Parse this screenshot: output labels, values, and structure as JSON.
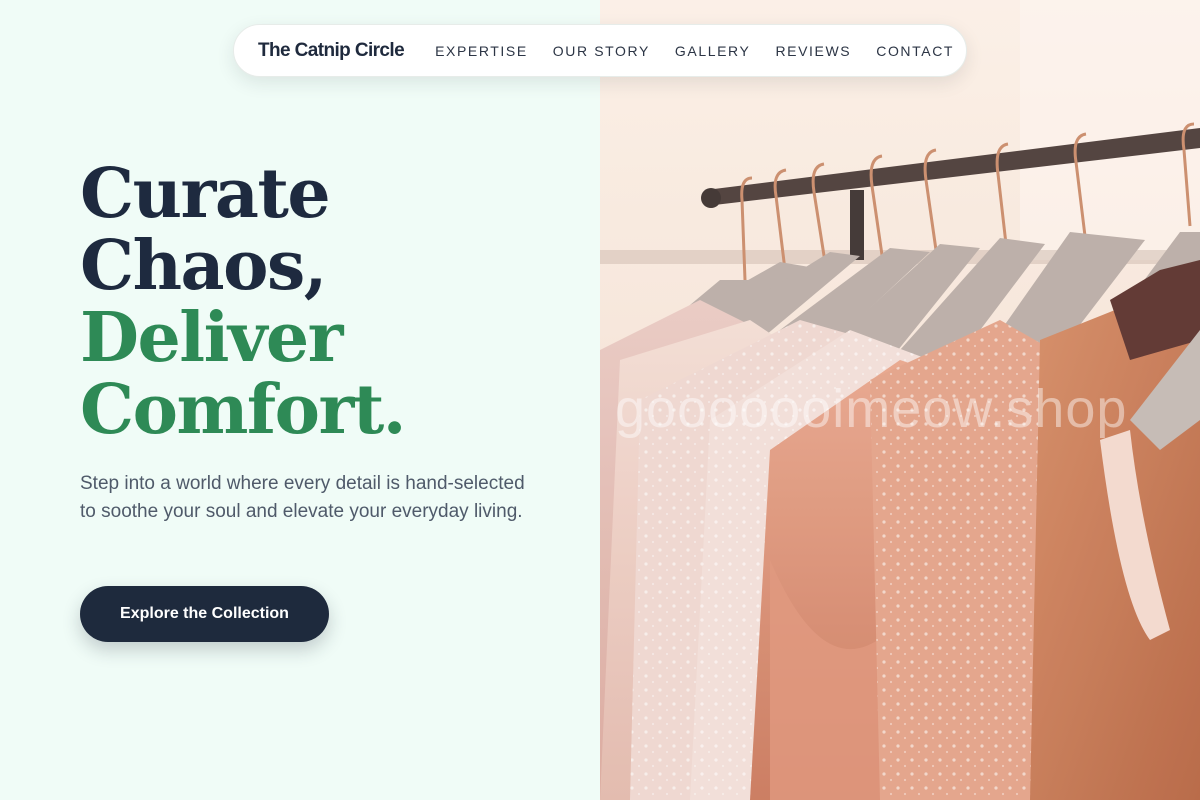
{
  "nav": {
    "brand": "The Catnip Circle",
    "links": [
      "EXPERTISE",
      "OUR STORY",
      "GALLERY",
      "REVIEWS",
      "CONTACT"
    ]
  },
  "hero": {
    "headline_lines": [
      "Curate",
      "Chaos,",
      "Deliver",
      "Comfort."
    ],
    "subtext": "Step into a world where every detail is hand-selected to soothe your soul and elevate your everyday living.",
    "cta_label": "Explore the Collection"
  },
  "image": {
    "alt": "Pastel lace dresses hanging on a clothing rack",
    "watermark": "gooooooimeow.shop"
  },
  "colors": {
    "background": "#f0fcf7",
    "dark": "#1e2a3f",
    "accent_green": "#2e8a56",
    "body_text": "#4f5a6a"
  }
}
